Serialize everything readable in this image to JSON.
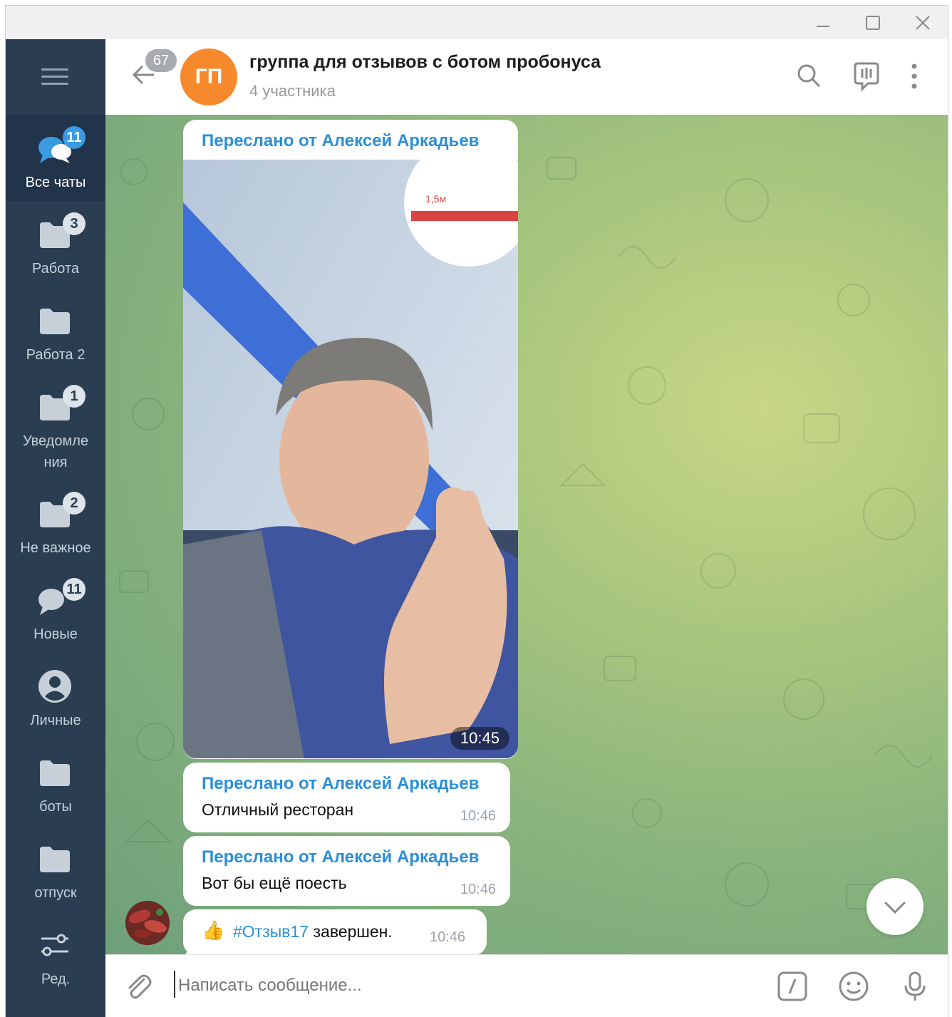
{
  "window": {
    "controls": {
      "minimize": "minimize-icon",
      "maximize": "maximize-icon",
      "close": "close-icon"
    }
  },
  "sidebar": {
    "folders": [
      {
        "label": "Все чаты",
        "badge": "11",
        "icon": "chats-icon",
        "active": true
      },
      {
        "label": "Работа",
        "badge": "3",
        "icon": "folder-icon"
      },
      {
        "label": "Работа 2",
        "badge": "",
        "icon": "folder-icon"
      },
      {
        "label_line1": "Уведомле",
        "label_line2": "ния",
        "badge": "1",
        "icon": "folder-icon"
      },
      {
        "label": "Не важное",
        "badge": "2",
        "icon": "folder-icon"
      },
      {
        "label": "Новые",
        "badge": "11",
        "icon": "chats-icon"
      },
      {
        "label": "Личные",
        "badge": "",
        "icon": "person-icon"
      },
      {
        "label": "боты",
        "badge": "",
        "icon": "folder-icon"
      },
      {
        "label": "отпуск",
        "badge": "",
        "icon": "folder-icon"
      },
      {
        "label": "Ред.",
        "badge": "",
        "icon": "settings-sliders-icon"
      }
    ]
  },
  "header": {
    "back_badge": "67",
    "avatar_initials": "ГП",
    "avatar_color": "#f6892c",
    "title": "группа для отзывов с ботом пробонуса",
    "subtitle": "4 участника"
  },
  "messages": [
    {
      "forwarded_from": "Переслано от Алексей Аркадьев",
      "type": "photo",
      "time": "10:45"
    },
    {
      "forwarded_from": "Переслано от Алексей Аркадьев",
      "text": "Отличный ресторан",
      "time": "10:46"
    },
    {
      "forwarded_from": "Переслано от Алексей Аркадьев",
      "text": "Вот бы ещё поесть",
      "time": "10:46"
    },
    {
      "emoji": "👍",
      "hashtag": "#Отзыв17",
      "text": " завершен.",
      "time": "10:46"
    }
  ],
  "composer": {
    "placeholder": "Написать сообщение..."
  },
  "colors": {
    "sidebar_bg": "#2a3d51",
    "accent": "#2a8fd8",
    "badge_active": "#3a9be0"
  }
}
